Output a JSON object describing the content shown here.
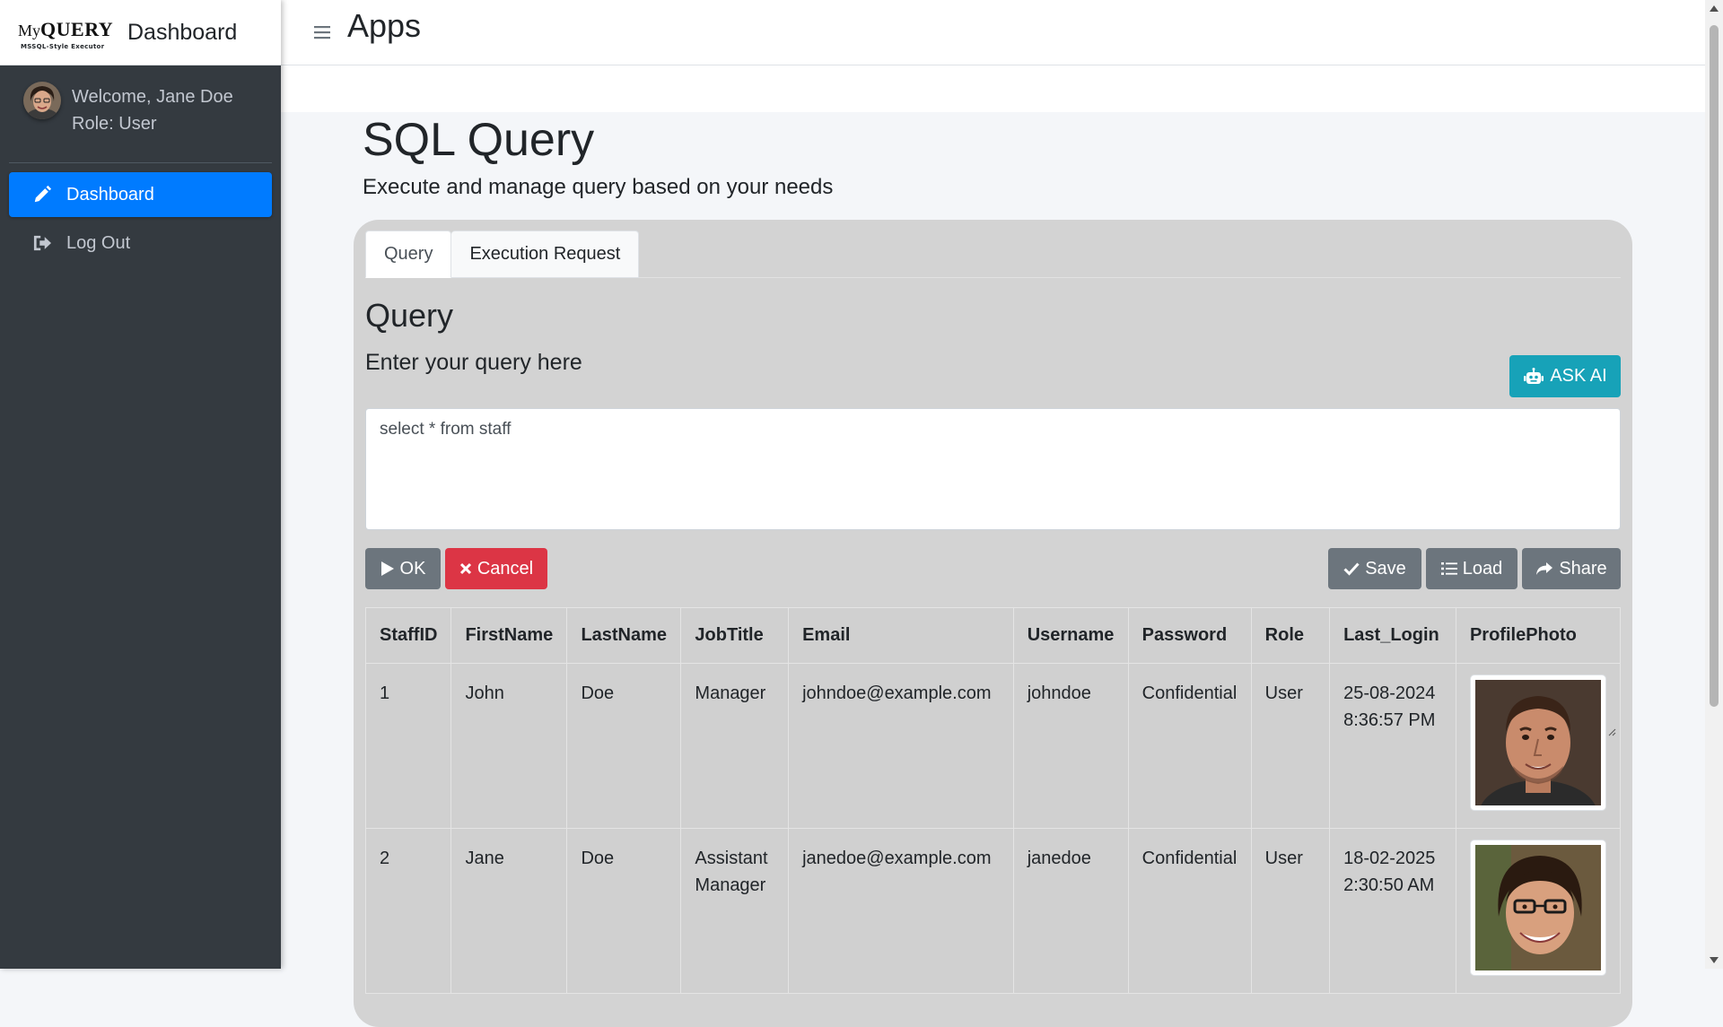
{
  "brand": {
    "logo_my": "My",
    "logo_query": "QUERY",
    "logo_sub": "MSSQL-Style Executor",
    "title": "Dashboard"
  },
  "user": {
    "welcome": "Welcome, Jane Doe",
    "role": "Role: User"
  },
  "sidebar": {
    "items": [
      {
        "label": "Dashboard",
        "icon": "pencil-icon",
        "active": true
      },
      {
        "label": "Log Out",
        "icon": "sign-out-icon",
        "active": false
      }
    ]
  },
  "topbar": {
    "title": "Apps",
    "menu_icon": "hamburger-menu-icon"
  },
  "page": {
    "title": "SQL Query",
    "subtitle": "Execute and manage query based on your needs"
  },
  "tabs": [
    {
      "label": "Query",
      "active": true
    },
    {
      "label": "Execution Request",
      "active": false
    }
  ],
  "query": {
    "heading": "Query",
    "prompt": "Enter your query here",
    "ask_ai_label": "ASK AI",
    "ask_ai_icon": "robot-icon",
    "input_value": "select * from staff"
  },
  "actions": {
    "ok": "OK",
    "cancel": "Cancel",
    "save": "Save",
    "load": "Load",
    "share": "Share"
  },
  "table": {
    "columns": [
      "StaffID",
      "FirstName",
      "LastName",
      "JobTitle",
      "Email",
      "Username",
      "Password",
      "Role",
      "Last_Login",
      "ProfilePhoto"
    ],
    "rows": [
      {
        "StaffID": "1",
        "FirstName": "John",
        "LastName": "Doe",
        "JobTitle": "Manager",
        "Email": "johndoe@example.com",
        "Username": "johndoe",
        "Password": "Confidential",
        "Role": "User",
        "Last_Login_date": "25-08-2024",
        "Last_Login_time": "8:36:57 PM",
        "ProfilePhoto": "male-portrait-photo"
      },
      {
        "StaffID": "2",
        "FirstName": "Jane",
        "LastName": "Doe",
        "JobTitle_line1": "Assistant",
        "JobTitle_line2": "Manager",
        "Email": "janedoe@example.com",
        "Username": "janedoe",
        "Password": "Confidential",
        "Role": "User",
        "Last_Login_date": "18-02-2025",
        "Last_Login_time": "2:30:50 AM",
        "ProfilePhoto": "female-portrait-photo"
      }
    ]
  },
  "colors": {
    "sidebar_bg": "#343a40",
    "primary": "#007bff",
    "info": "#17a2b8",
    "secondary": "#6c757d",
    "danger": "#dc3545",
    "card_bg": "#d3d3d3"
  }
}
